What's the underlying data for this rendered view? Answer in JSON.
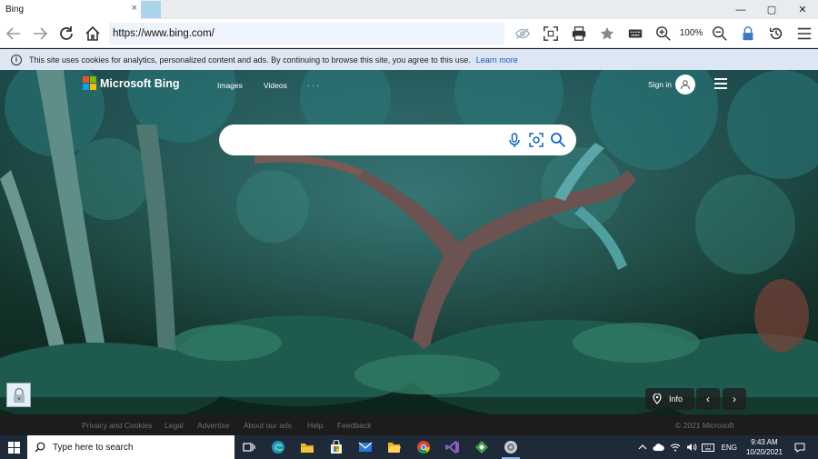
{
  "tab": {
    "title": "Bing",
    "close": "×"
  },
  "window_controls": {
    "minimize": "—",
    "maximize": "▢",
    "close": "✕"
  },
  "address": {
    "url": "https://www.bing.com/"
  },
  "toolbar": {
    "zoom_level": "100%"
  },
  "cookie_bar": {
    "message": "This site uses cookies for analytics, personalized content and ads. By continuing to browse this site, you agree to this use.",
    "learn_more": "Learn more"
  },
  "bing": {
    "logo_text": "Microsoft Bing",
    "nav": [
      "Images",
      "Videos",
      "· · ·"
    ],
    "sign_in": "Sign in",
    "search_value": "",
    "info_label": "Info",
    "prev": "‹",
    "next": "›"
  },
  "footer": {
    "links": [
      "Privacy and Cookies",
      "Legal",
      "Advertise",
      "About our ads",
      "Help",
      "Feedback"
    ],
    "copyright": "© 2021 Microsoft"
  },
  "taskbar": {
    "search_placeholder": "Type here to search",
    "language": "ENG",
    "time": "9:43 AM",
    "date": "10/20/2021"
  },
  "colors": {
    "logo_red": "#f25022",
    "logo_green": "#7fba00",
    "logo_blue": "#00a4ef",
    "logo_yellow": "#ffb900",
    "search_icon_blue": "#0e64c5",
    "cookie_bar_bg": "#dde6f3",
    "taskbar_bg": "#1f2a38"
  }
}
